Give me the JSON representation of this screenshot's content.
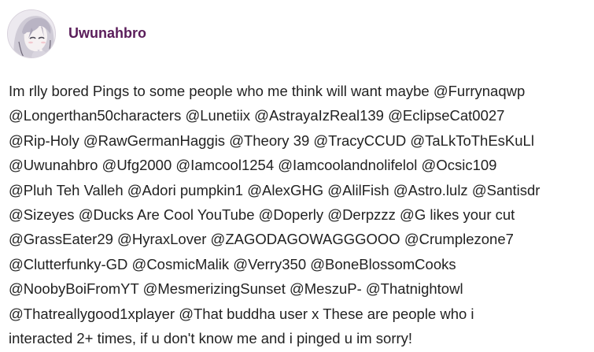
{
  "post": {
    "author": {
      "username": "Uwunahbro",
      "avatar_icon": "anime-girl-avatar"
    },
    "body_lines": [
      "Im rlly bored Pings to some people who me think will want maybe @Furrynaqwp",
      "@Longerthan50characters @Lunetiix @AstrayaIzReal139 @EclipseCat0027",
      "@Rip-Holy @RawGermanHaggis @Theory 39 @TracyCCUD @TaLkToThEsKuLl",
      "@Uwunahbro @Ufg2000 @Iamcool1254 @Iamcoolandnolifelol @Ocsic109",
      "@Pluh Teh Valleh @Adori pumpkin1 @AlexGHG @AlilFish @Astro.lulz @Santisdr",
      "@Sizeyes @Ducks Are Cool YouTube @Doperly @Derpzzz @G likes your cut",
      "@GrassEater29 @HyraxLover @ZAGODAGOWAGGGOOO @Crumplezone7",
      "@Clutterfunky-GD @CosmicMalik @Verry350 @BoneBlossomCooks",
      "@NoobyBoiFromYT @MesmerizingSunset @MeszuP- @Thatnightowl",
      "@Thatreallygood1xplayer @That buddha user x These are people who i",
      "interacted 2+ times, if u don't know me and i pinged u im sorry!"
    ]
  },
  "colors": {
    "username": "#5a1d5a",
    "text": "#222222",
    "background": "#ffffff"
  }
}
